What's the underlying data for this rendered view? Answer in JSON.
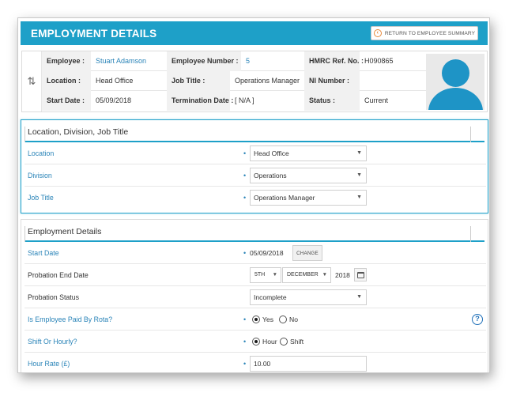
{
  "header": {
    "title": "EMPLOYMENT DETAILS",
    "return_button": "RETURN TO EMPLOYEE SUMMARY"
  },
  "summary": {
    "employee_label": "Employee :",
    "employee_value": "Stuart Adamson",
    "employee_number_label": "Employee Number :",
    "employee_number_value": "5",
    "hmrc_label": "HMRC Ref. No. :",
    "hmrc_value": "H090865",
    "location_label": "Location :",
    "location_value": "Head Office",
    "job_title_label": "Job Title :",
    "job_title_value": "Operations Manager",
    "ni_label": "NI Number :",
    "ni_value": "",
    "start_date_label": "Start Date :",
    "start_date_value": "05/09/2018",
    "termination_label": "Termination Date :",
    "termination_value": "[ N/A ]",
    "status_label": "Status :",
    "status_value": "Current"
  },
  "location_panel": {
    "title": "Location, Division, Job Title",
    "location_label": "Location",
    "location_value": "Head Office",
    "division_label": "Division",
    "division_value": "Operations",
    "job_title_label": "Job Title",
    "job_title_value": "Operations Manager"
  },
  "employment_panel": {
    "title": "Employment Details",
    "start_date_label": "Start Date",
    "start_date_value": "05/09/2018",
    "change_button": "CHANGE",
    "probation_end_label": "Probation End Date",
    "probation_day": "5TH",
    "probation_month": "DECEMBER",
    "probation_year": "2018",
    "probation_status_label": "Probation Status",
    "probation_status_value": "Incomplete",
    "paid_by_rota_label": "Is Employee Paid By Rota?",
    "rota_yes": "Yes",
    "rota_no": "No",
    "rota_selected": "Yes",
    "shift_or_hourly_label": "Shift Or Hourly?",
    "hour_option": "Hour",
    "shift_option": "Shift",
    "shift_selected": "Hour",
    "hour_rate_label": "Hour Rate (£)",
    "hour_rate_value": "10.00",
    "help_glyph": "?"
  },
  "required_marker": "•",
  "colors": {
    "accent": "#1ea0c8",
    "link": "#2a84b8",
    "avatar": "#1e94c6"
  },
  "icons": [
    "return-arrow-icon",
    "swap-arrows-icon",
    "avatar-icon",
    "dropdown-arrow-icon",
    "calendar-icon",
    "help-icon"
  ]
}
